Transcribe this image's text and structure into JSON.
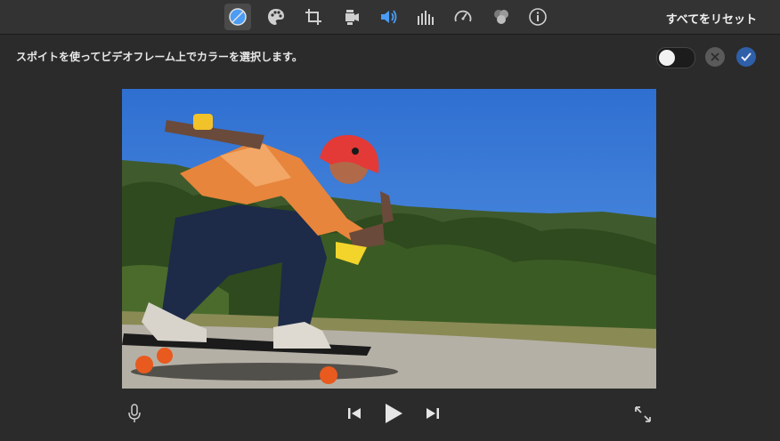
{
  "toolbar": {
    "tools": [
      {
        "icon": "color-balance-icon",
        "active": true
      },
      {
        "icon": "color-palette-icon"
      },
      {
        "icon": "crop-icon"
      },
      {
        "icon": "stabilization-camera-icon"
      },
      {
        "icon": "volume-icon",
        "highlight_color": "#4a9cf5"
      },
      {
        "icon": "equalizer-icon"
      },
      {
        "icon": "speed-icon"
      },
      {
        "icon": "video-filter-icon"
      },
      {
        "icon": "info-icon"
      }
    ],
    "reset_label": "すべてをリセット"
  },
  "color_picker": {
    "instruction": "スポイトを使ってビデオフレーム上でカラーを選択します。",
    "toggle_on": false
  },
  "player": {
    "controls": [
      "microphone-icon",
      "skip-back-icon",
      "play-icon",
      "skip-forward-icon",
      "fullscreen-icon"
    ]
  },
  "colors": {
    "background": "#2b2b2b",
    "toolbar": "#333333",
    "accent": "#4a9cf5",
    "confirm": "#2f5fa8"
  }
}
